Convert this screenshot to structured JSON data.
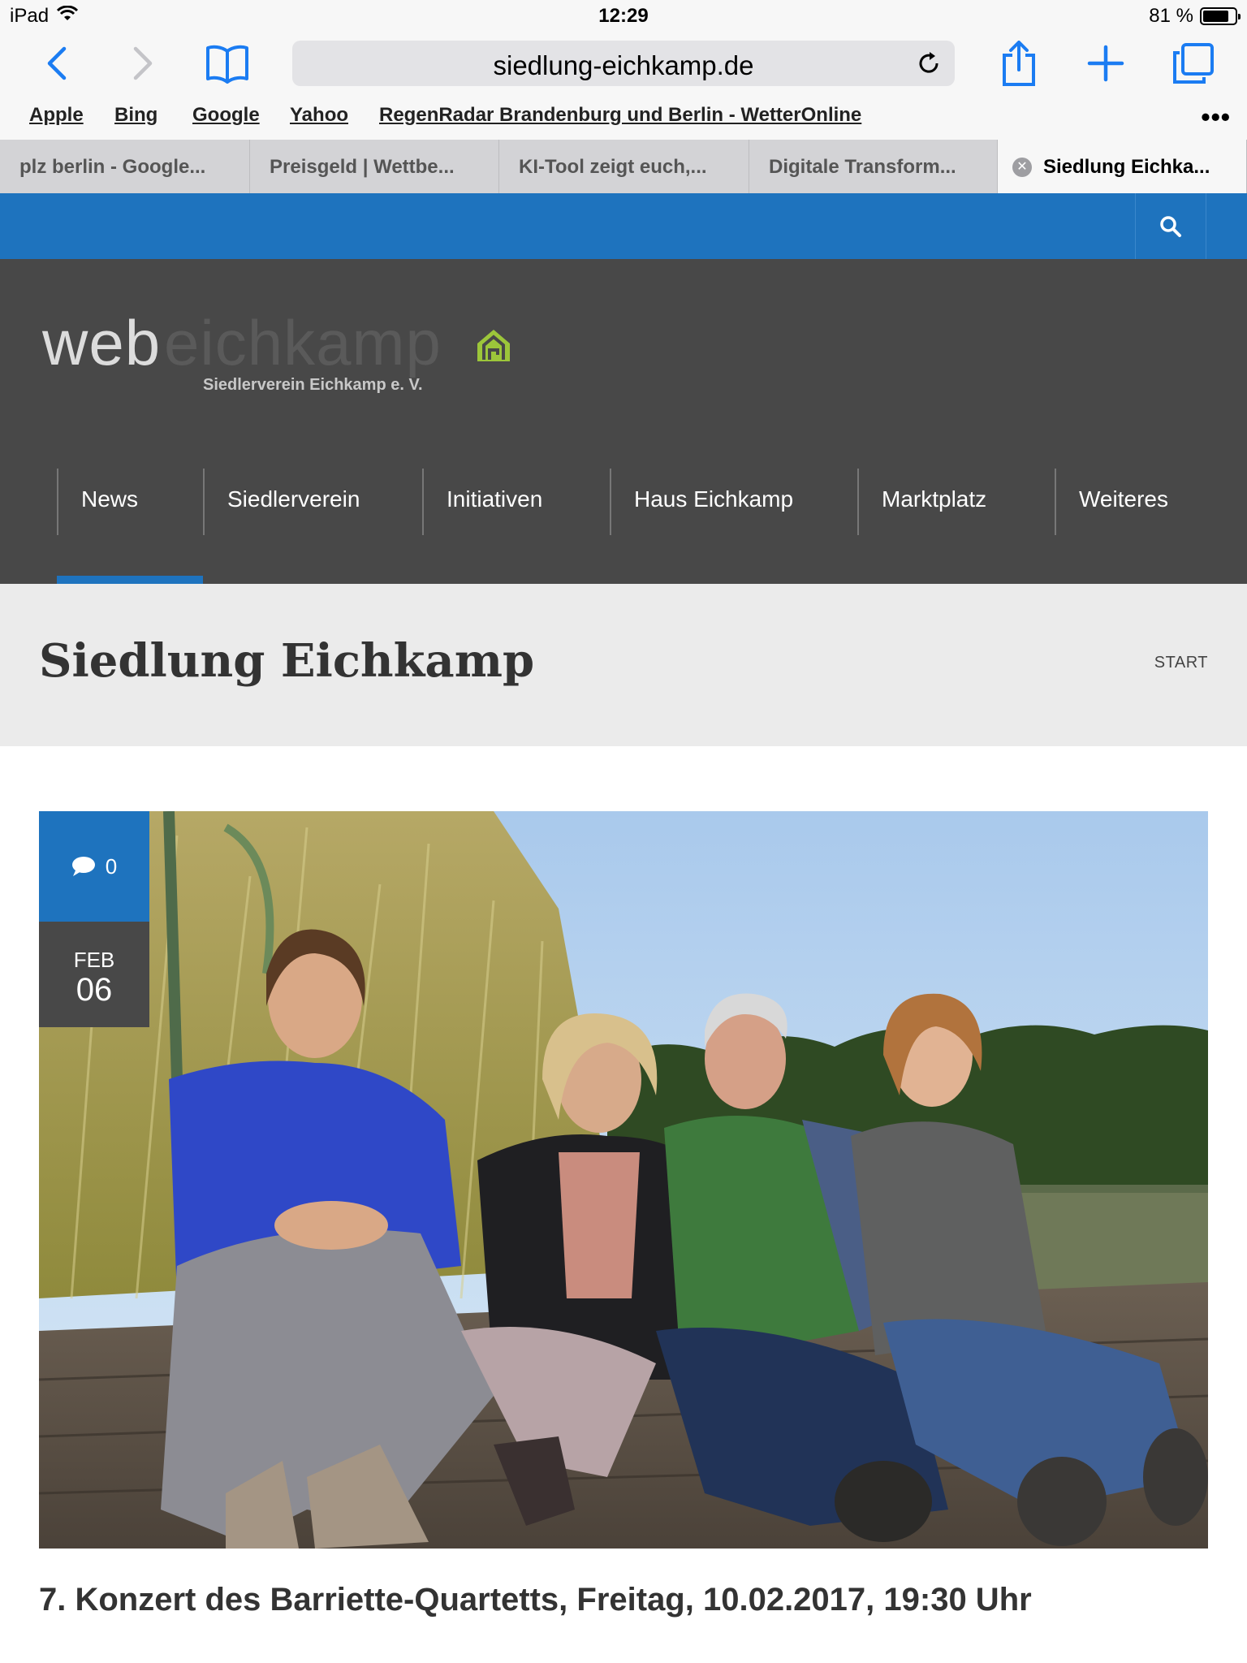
{
  "status": {
    "device": "iPad",
    "time": "12:29",
    "battery": "81 %",
    "battery_level": 0.81
  },
  "browser": {
    "url": "siedlung-eichkamp.de",
    "bookmarks": [
      "Apple",
      "Bing",
      "Google",
      "Yahoo",
      "RegenRadar Brandenburg und Berlin - WetterOnline"
    ],
    "tabs": [
      {
        "label": "plz berlin - Google..."
      },
      {
        "label": "Preisgeld | Wettbe..."
      },
      {
        "label": "KI-Tool zeigt euch,..."
      },
      {
        "label": "Digitale Transform..."
      },
      {
        "label": "Siedlung Eichka..."
      }
    ]
  },
  "site": {
    "logo_web": "web",
    "logo_eichkamp": "eichkamp",
    "logo_subtitle": "Siedlerverein Eichkamp e. V.",
    "nav": [
      "News",
      "Siedlerverein",
      "Initiativen",
      "Haus Eichkamp",
      "Marktplatz",
      "Weiteres"
    ],
    "active_nav": "News",
    "brand_color": "#1e73be"
  },
  "page": {
    "title": "Siedlung Eichkamp",
    "breadcrumb": "START"
  },
  "post": {
    "comments": "0",
    "month": "FEB",
    "day": "06",
    "title": "7. Konzert des Barriette-Quartetts, Freitag, 10.02.2017, 19:30 Uhr"
  }
}
